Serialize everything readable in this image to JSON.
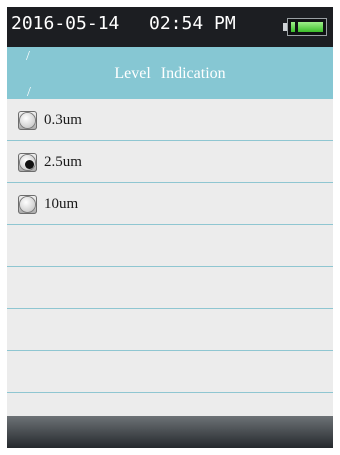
{
  "status": {
    "date": "2016-05-14",
    "time": "02:54 PM",
    "battery_icon": "battery-icon",
    "battery_level": 0.85
  },
  "header": {
    "word1": "Level",
    "word2": "Indication"
  },
  "options": [
    {
      "label": "0.3um",
      "selected": false
    },
    {
      "label": "2.5um",
      "selected": true
    },
    {
      "label": "10um",
      "selected": false
    }
  ],
  "colors": {
    "title_bar": "#86c7d3",
    "status_bar": "#1c1e22",
    "list_bg": "#ececec",
    "row_divider": "#8fc6d1"
  }
}
